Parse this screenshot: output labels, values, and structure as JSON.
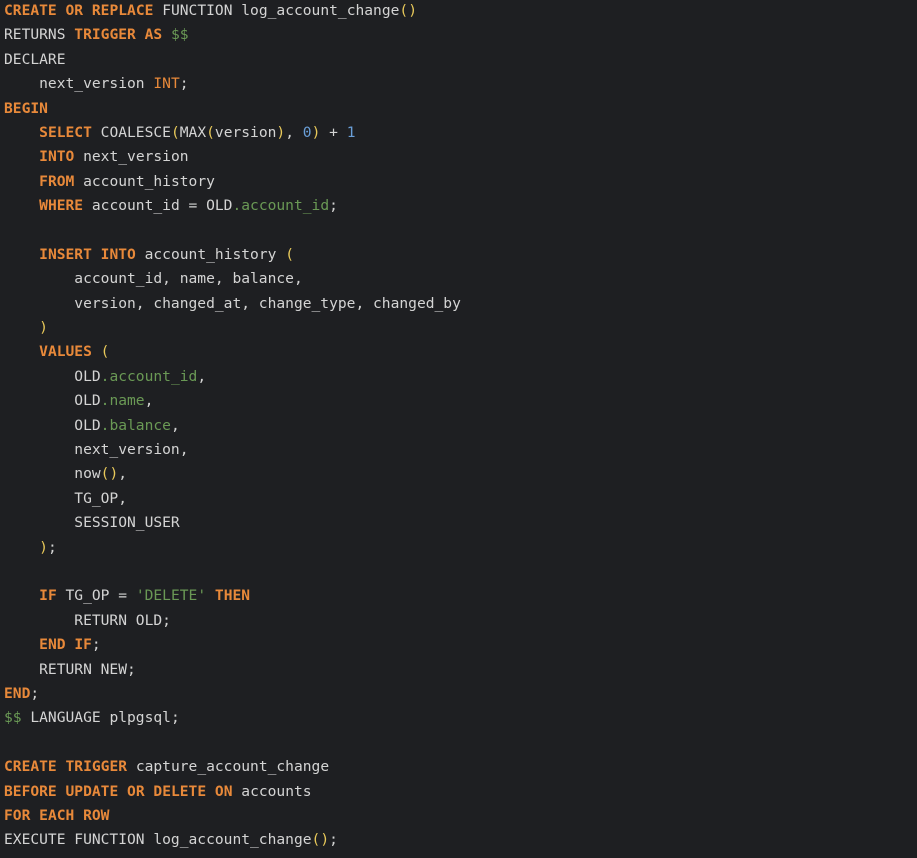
{
  "editor": {
    "language": "plpgsql",
    "colors": {
      "background": "#1e1f22",
      "keyword": "#e8893a",
      "text": "#d4d4d4",
      "property": "#6a9955",
      "number": "#6a9fd8",
      "string": "#6a9955",
      "bracket": "#e8c95a"
    },
    "lines": [
      [
        {
          "t": "kw",
          "v": "CREATE"
        },
        {
          "t": "txt",
          "v": " "
        },
        {
          "t": "kw",
          "v": "OR"
        },
        {
          "t": "txt",
          "v": " "
        },
        {
          "t": "kw",
          "v": "REPLACE"
        },
        {
          "t": "txt",
          "v": " FUNCTION log_account_change"
        },
        {
          "t": "brk",
          "v": "()"
        }
      ],
      [
        {
          "t": "txt",
          "v": "RETURNS "
        },
        {
          "t": "kw",
          "v": "TRIGGER"
        },
        {
          "t": "txt",
          "v": " "
        },
        {
          "t": "kw",
          "v": "AS"
        },
        {
          "t": "txt",
          "v": " "
        },
        {
          "t": "dol",
          "v": "$$"
        }
      ],
      [
        {
          "t": "txt",
          "v": "DECLARE"
        }
      ],
      [
        {
          "t": "txt",
          "v": "    next_version "
        },
        {
          "t": "ty",
          "v": "INT"
        },
        {
          "t": "txt",
          "v": ";"
        }
      ],
      [
        {
          "t": "kw",
          "v": "BEGIN"
        }
      ],
      [
        {
          "t": "txt",
          "v": "    "
        },
        {
          "t": "kw",
          "v": "SELECT"
        },
        {
          "t": "txt",
          "v": " COALESCE"
        },
        {
          "t": "brk",
          "v": "("
        },
        {
          "t": "txt",
          "v": "MAX"
        },
        {
          "t": "brk",
          "v": "("
        },
        {
          "t": "txt",
          "v": "version"
        },
        {
          "t": "brk",
          "v": ")"
        },
        {
          "t": "txt",
          "v": ", "
        },
        {
          "t": "num",
          "v": "0"
        },
        {
          "t": "brk",
          "v": ")"
        },
        {
          "t": "txt",
          "v": " + "
        },
        {
          "t": "num",
          "v": "1"
        }
      ],
      [
        {
          "t": "txt",
          "v": "    "
        },
        {
          "t": "kw",
          "v": "INTO"
        },
        {
          "t": "txt",
          "v": " next_version"
        }
      ],
      [
        {
          "t": "txt",
          "v": "    "
        },
        {
          "t": "kw",
          "v": "FROM"
        },
        {
          "t": "txt",
          "v": " account_history"
        }
      ],
      [
        {
          "t": "txt",
          "v": "    "
        },
        {
          "t": "kw",
          "v": "WHERE"
        },
        {
          "t": "txt",
          "v": " account_id = OLD"
        },
        {
          "t": "prop",
          "v": ".account_id"
        },
        {
          "t": "txt",
          "v": ";"
        }
      ],
      [],
      [
        {
          "t": "txt",
          "v": "    "
        },
        {
          "t": "kw",
          "v": "INSERT"
        },
        {
          "t": "txt",
          "v": " "
        },
        {
          "t": "kw",
          "v": "INTO"
        },
        {
          "t": "txt",
          "v": " account_history "
        },
        {
          "t": "brk",
          "v": "("
        }
      ],
      [
        {
          "t": "txt",
          "v": "        account_id, name, balance,"
        }
      ],
      [
        {
          "t": "txt",
          "v": "        version, changed_at, change_type, changed_by"
        }
      ],
      [
        {
          "t": "txt",
          "v": "    "
        },
        {
          "t": "brk",
          "v": ")"
        }
      ],
      [
        {
          "t": "txt",
          "v": "    "
        },
        {
          "t": "kw",
          "v": "VALUES"
        },
        {
          "t": "txt",
          "v": " "
        },
        {
          "t": "brk",
          "v": "("
        }
      ],
      [
        {
          "t": "txt",
          "v": "        OLD"
        },
        {
          "t": "prop",
          "v": ".account_id"
        },
        {
          "t": "txt",
          "v": ","
        }
      ],
      [
        {
          "t": "txt",
          "v": "        OLD"
        },
        {
          "t": "prop",
          "v": ".name"
        },
        {
          "t": "txt",
          "v": ","
        }
      ],
      [
        {
          "t": "txt",
          "v": "        OLD"
        },
        {
          "t": "prop",
          "v": ".balance"
        },
        {
          "t": "txt",
          "v": ","
        }
      ],
      [
        {
          "t": "txt",
          "v": "        next_version,"
        }
      ],
      [
        {
          "t": "txt",
          "v": "        now"
        },
        {
          "t": "brk",
          "v": "()"
        },
        {
          "t": "txt",
          "v": ","
        }
      ],
      [
        {
          "t": "txt",
          "v": "        TG_OP,"
        }
      ],
      [
        {
          "t": "txt",
          "v": "        SESSION_USER"
        }
      ],
      [
        {
          "t": "txt",
          "v": "    "
        },
        {
          "t": "brk",
          "v": ")"
        },
        {
          "t": "txt",
          "v": ";"
        }
      ],
      [],
      [
        {
          "t": "txt",
          "v": "    "
        },
        {
          "t": "kw",
          "v": "IF"
        },
        {
          "t": "txt",
          "v": " TG_OP = "
        },
        {
          "t": "str",
          "v": "'DELETE'"
        },
        {
          "t": "txt",
          "v": " "
        },
        {
          "t": "kw",
          "v": "THEN"
        }
      ],
      [
        {
          "t": "txt",
          "v": "        RETURN OLD;"
        }
      ],
      [
        {
          "t": "txt",
          "v": "    "
        },
        {
          "t": "kw",
          "v": "END"
        },
        {
          "t": "txt",
          "v": " "
        },
        {
          "t": "kw",
          "v": "IF"
        },
        {
          "t": "txt",
          "v": ";"
        }
      ],
      [
        {
          "t": "txt",
          "v": "    RETURN NEW;"
        }
      ],
      [
        {
          "t": "kw",
          "v": "END"
        },
        {
          "t": "txt",
          "v": ";"
        }
      ],
      [
        {
          "t": "dol",
          "v": "$$"
        },
        {
          "t": "txt",
          "v": " LANGUAGE plpgsql;"
        }
      ],
      [],
      [
        {
          "t": "kw",
          "v": "CREATE"
        },
        {
          "t": "txt",
          "v": " "
        },
        {
          "t": "kw",
          "v": "TRIGGER"
        },
        {
          "t": "txt",
          "v": " capture_account_change"
        }
      ],
      [
        {
          "t": "kw",
          "v": "BEFORE"
        },
        {
          "t": "txt",
          "v": " "
        },
        {
          "t": "kw",
          "v": "UPDATE"
        },
        {
          "t": "txt",
          "v": " "
        },
        {
          "t": "kw",
          "v": "OR"
        },
        {
          "t": "txt",
          "v": " "
        },
        {
          "t": "kw",
          "v": "DELETE"
        },
        {
          "t": "txt",
          "v": " "
        },
        {
          "t": "kw",
          "v": "ON"
        },
        {
          "t": "txt",
          "v": " accounts"
        }
      ],
      [
        {
          "t": "kw",
          "v": "FOR"
        },
        {
          "t": "txt",
          "v": " "
        },
        {
          "t": "kw",
          "v": "EACH"
        },
        {
          "t": "txt",
          "v": " "
        },
        {
          "t": "kw",
          "v": "ROW"
        }
      ],
      [
        {
          "t": "txt",
          "v": "EXECUTE FUNCTION log_account_change"
        },
        {
          "t": "brk",
          "v": "()"
        },
        {
          "t": "txt",
          "v": ";"
        }
      ]
    ]
  }
}
